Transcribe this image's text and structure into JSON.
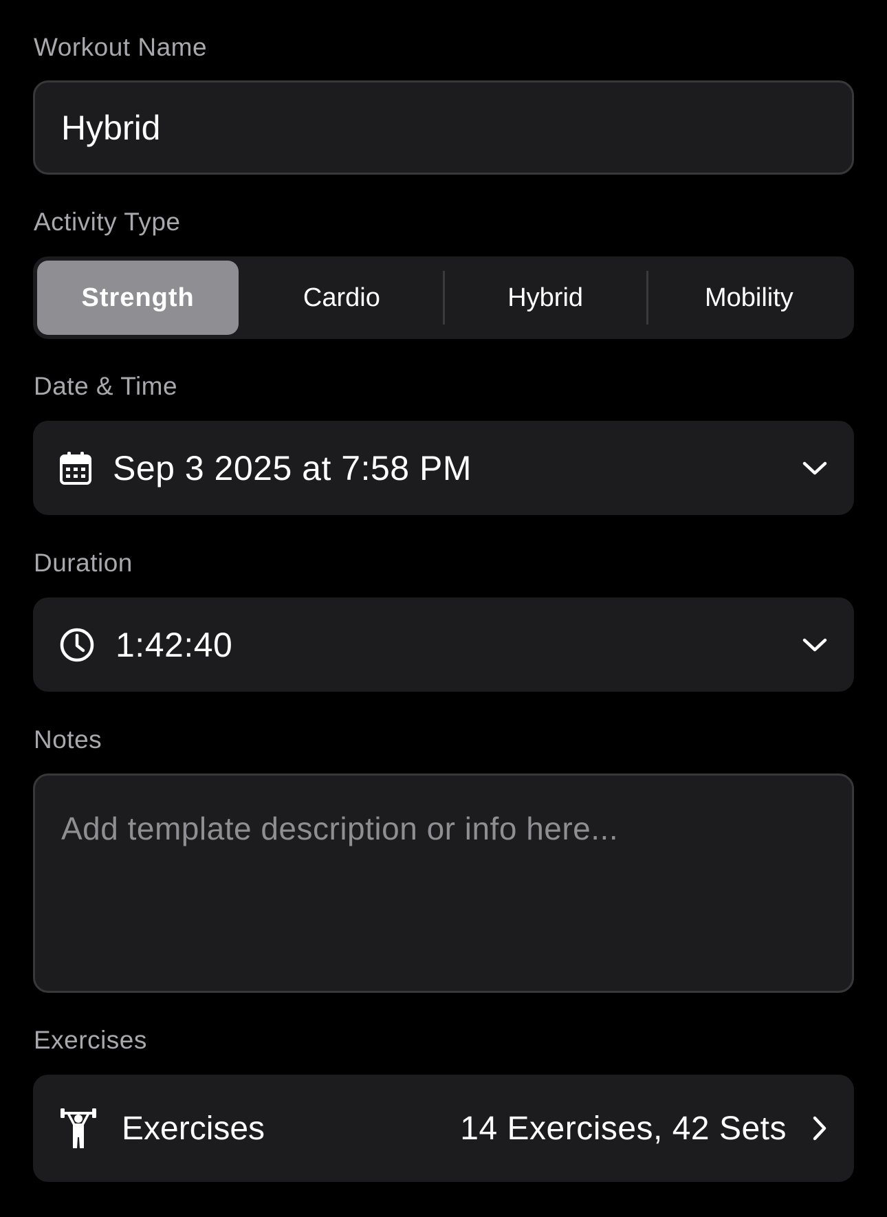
{
  "workout_name": {
    "label": "Workout Name",
    "value": "Hybrid"
  },
  "activity_type": {
    "label": "Activity Type",
    "options": [
      "Strength",
      "Cardio",
      "Hybrid",
      "Mobility"
    ],
    "selected": "Strength"
  },
  "date_time": {
    "label": "Date & Time",
    "value": "Sep 3 2025 at 7:58 PM",
    "icon": "calendar-icon",
    "chevron": "chevron-down-icon"
  },
  "duration": {
    "label": "Duration",
    "value": "1:42:40",
    "icon": "clock-icon",
    "chevron": "chevron-down-icon"
  },
  "notes": {
    "label": "Notes",
    "placeholder": "Add template description or info here..."
  },
  "exercises": {
    "label": "Exercises",
    "row_title": "Exercises",
    "summary": "14 Exercises, 42 Sets",
    "icon": "weightlifter-icon",
    "chevron": "chevron-right-icon"
  },
  "colors": {
    "background": "#000000",
    "field": "#1c1c1e",
    "selected_segment": "#8e8e93",
    "label": "#a8a8ad",
    "placeholder": "#8e8e93"
  }
}
